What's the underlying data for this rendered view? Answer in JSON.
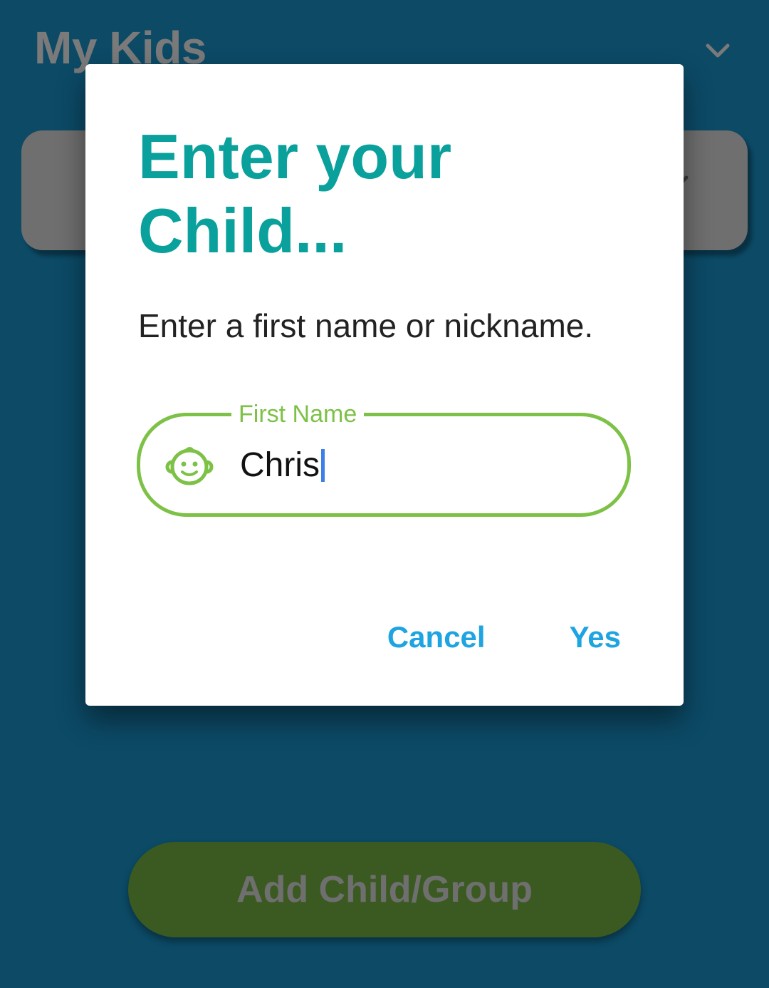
{
  "header": {
    "title": "My Kids",
    "chevron_icon": "chevron-down-icon"
  },
  "background_button": {
    "label": "Add Child/Group"
  },
  "dialog": {
    "title": "Enter your Child...",
    "subtitle": "Enter a first name or nickname.",
    "field": {
      "label": "First Name",
      "value": "Chris",
      "icon": "child-face-icon"
    },
    "cancel_label": "Cancel",
    "yes_label": "Yes"
  },
  "colors": {
    "background": "#0c4a66",
    "dialog_title": "#0aa09c",
    "field_accent": "#7dc147",
    "action": "#1ea4e0"
  }
}
